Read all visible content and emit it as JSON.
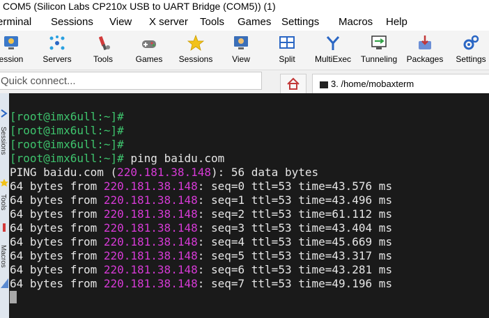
{
  "window": {
    "title": "COM5  (Silicon Labs CP210x USB to UART Bridge (COM5)) (1)"
  },
  "menu": [
    "erminal",
    "Sessions",
    "View",
    "X server",
    "Tools",
    "Games",
    "Settings",
    "Macros",
    "Help"
  ],
  "toolbar": {
    "items": [
      {
        "label": "ession",
        "icon": "session-icon"
      },
      {
        "label": "Servers",
        "icon": "servers-icon"
      },
      {
        "label": "Tools",
        "icon": "tools-icon"
      },
      {
        "label": "Games",
        "icon": "games-icon"
      },
      {
        "label": "Sessions",
        "icon": "star-icon"
      },
      {
        "label": "View",
        "icon": "view-icon"
      },
      {
        "label": "Split",
        "icon": "split-icon"
      },
      {
        "label": "MultiExec",
        "icon": "multiexec-icon"
      },
      {
        "label": "Tunneling",
        "icon": "tunneling-icon"
      },
      {
        "label": "Packages",
        "icon": "packages-icon"
      },
      {
        "label": "Settings",
        "icon": "settings-icon"
      }
    ]
  },
  "quick_connect": {
    "placeholder": "Quick connect..."
  },
  "tabs": {
    "terminal_tab_label": "3. /home/mobaxterm"
  },
  "sidebar": {
    "labels": [
      "Sessions",
      "Tools",
      "Macros"
    ]
  },
  "terminal": {
    "prompt": "[root@imx6ull:~]#",
    "command": " ping baidu.com",
    "ping_header": {
      "pre": "PING baidu.com (",
      "ip": "220.181.38.148",
      "post": "): 56 data bytes"
    },
    "reply_prefix": "64 bytes from ",
    "reply_ip": "220.181.38.148",
    "replies": [
      ": seq=0 ttl=53 time=43.576 ms",
      ": seq=1 ttl=53 time=43.496 ms",
      ": seq=2 ttl=53 time=61.112 ms",
      ": seq=3 ttl=53 time=43.404 ms",
      ": seq=4 ttl=53 time=45.669 ms",
      ": seq=5 ttl=53 time=43.317 ms",
      ": seq=6 ttl=53 time=43.281 ms",
      ": seq=7 ttl=53 time=49.196 ms"
    ]
  },
  "colors": {
    "prompt": "#3ec46d",
    "ip": "#d63ad6",
    "terminal_bg": "#1a1a1a"
  }
}
